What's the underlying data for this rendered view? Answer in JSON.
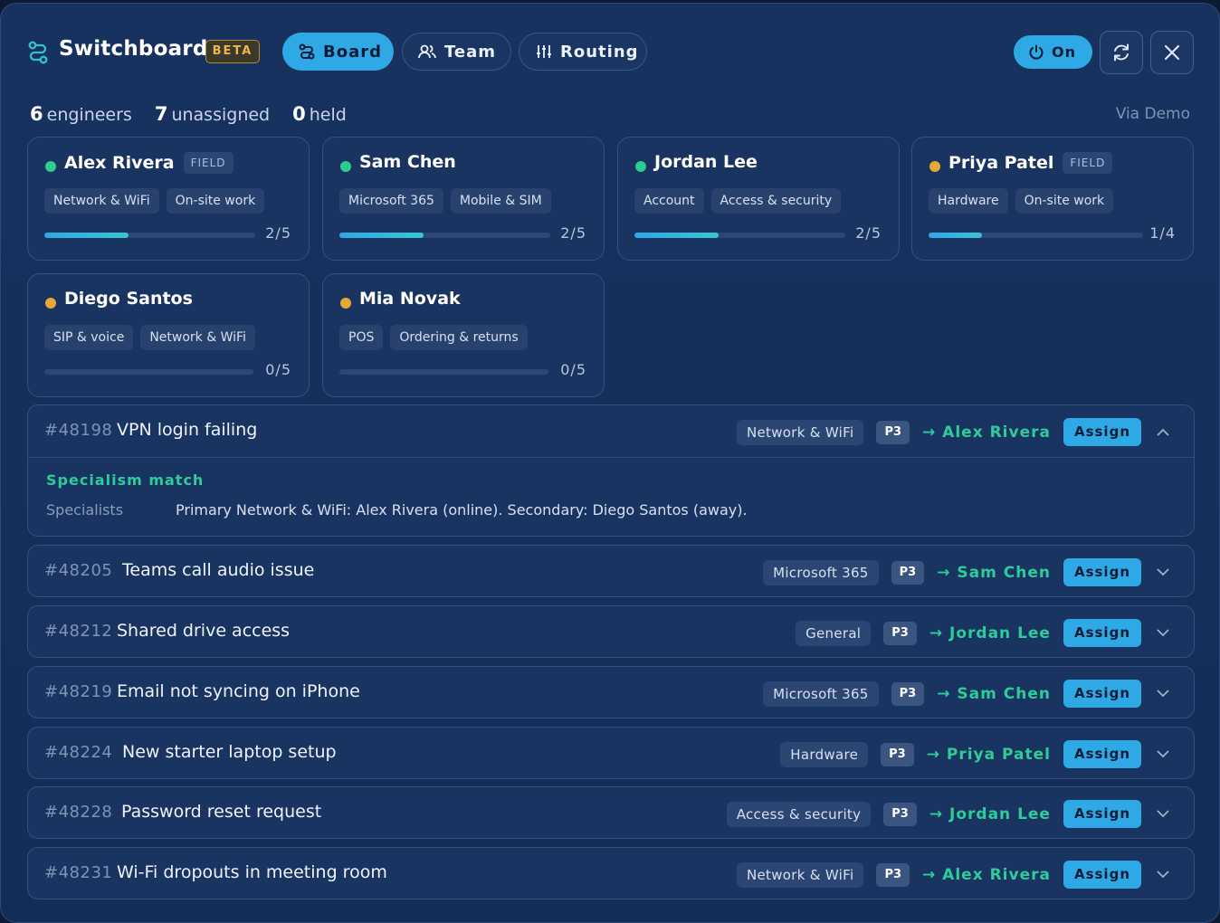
{
  "header": {
    "title": "Switchboard",
    "badge": "BETA",
    "tabs": [
      {
        "label": "Board",
        "icon": "board-icon",
        "active": true
      },
      {
        "label": "Team",
        "icon": "team-icon",
        "active": false
      },
      {
        "label": "Routing",
        "icon": "sliders-icon",
        "active": false
      }
    ],
    "toggle_label": "On",
    "colors": {
      "accent": "#2fa8e6",
      "online": "#2ecc8f",
      "away": "#e8a838",
      "suggest": "#2ecc9a"
    }
  },
  "stats": {
    "engineers_count": "6",
    "engineers_label": "engineers",
    "unassigned_count": "7",
    "unassigned_label": "unassigned",
    "held_count": "0",
    "held_label": "held",
    "source": "Via Demo"
  },
  "engineers": [
    {
      "name": "Alex Rivera",
      "status": "online",
      "badge": "FIELD",
      "skills": [
        "Network & WiFi",
        "On-site work"
      ],
      "load": "2/5",
      "load_fraction": 0.4
    },
    {
      "name": "Sam Chen",
      "status": "online",
      "badge": "",
      "skills": [
        "Microsoft 365",
        "Mobile & SIM"
      ],
      "load": "2/5",
      "load_fraction": 0.4
    },
    {
      "name": "Jordan Lee",
      "status": "online",
      "badge": "",
      "skills": [
        "Account",
        "Access & security"
      ],
      "load": "2/5",
      "load_fraction": 0.4
    },
    {
      "name": "Priya Patel",
      "status": "away",
      "badge": "FIELD",
      "skills": [
        "Hardware",
        "On-site work"
      ],
      "load": "1/4",
      "load_fraction": 0.25
    },
    {
      "name": "Diego Santos",
      "status": "away",
      "badge": "",
      "skills": [
        "SIP & voice",
        "Network & WiFi"
      ],
      "load": "0/5",
      "load_fraction": 0
    },
    {
      "name": "Mia Novak",
      "status": "away",
      "badge": "",
      "skills": [
        "POS",
        "Ordering & returns"
      ],
      "load": "0/5",
      "load_fraction": 0
    }
  ],
  "tickets": [
    {
      "id": "#48198",
      "title": "VPN login failing",
      "category": "Network & WiFi",
      "priority": "P3",
      "suggested": "→ Alex Rivera",
      "assign_label": "Assign",
      "expanded": true,
      "match_title": "Specialism match",
      "specialists_label": "Specialists",
      "specialists_text": "Primary Network & WiFi: Alex Rivera (online). Secondary: Diego Santos (away)."
    },
    {
      "id": "#48205",
      "title": "Teams call audio issue",
      "category": "Microsoft 365",
      "priority": "P3",
      "suggested": "→ Sam Chen",
      "assign_label": "Assign",
      "expanded": false
    },
    {
      "id": "#48212",
      "title": "Shared drive access",
      "category": "General",
      "priority": "P3",
      "suggested": "→ Jordan Lee",
      "assign_label": "Assign",
      "expanded": false
    },
    {
      "id": "#48219",
      "title": "Email not syncing on iPhone",
      "category": "Microsoft 365",
      "priority": "P3",
      "suggested": "→ Sam Chen",
      "assign_label": "Assign",
      "expanded": false
    },
    {
      "id": "#48224",
      "title": "New starter laptop setup",
      "category": "Hardware",
      "priority": "P3",
      "suggested": "→ Priya Patel",
      "assign_label": "Assign",
      "expanded": false
    },
    {
      "id": "#48228",
      "title": "Password reset request",
      "category": "Access & security",
      "priority": "P3",
      "suggested": "→ Jordan Lee",
      "assign_label": "Assign",
      "expanded": false
    },
    {
      "id": "#48231",
      "title": "Wi-Fi dropouts in meeting room",
      "category": "Network & WiFi",
      "priority": "P3",
      "suggested": "→ Alex Rivera",
      "assign_label": "Assign",
      "expanded": false
    }
  ]
}
